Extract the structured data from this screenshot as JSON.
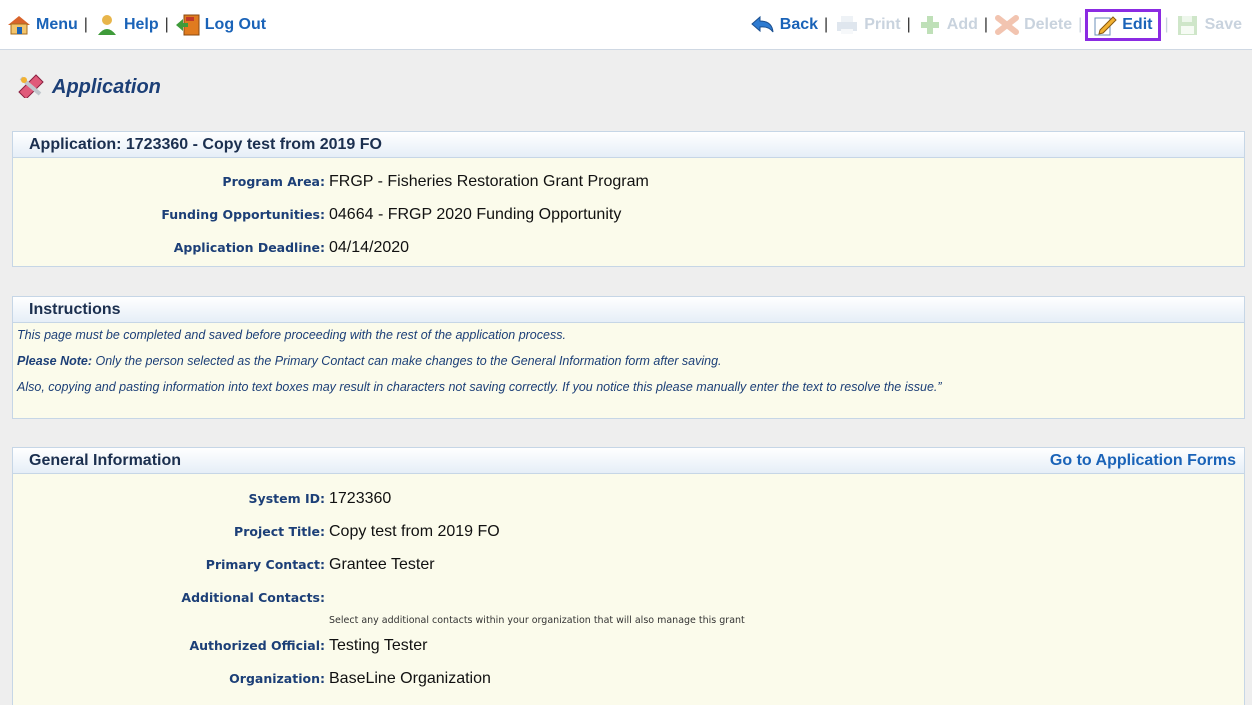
{
  "toolbar": {
    "menu": "Menu",
    "help": "Help",
    "logout": "Log Out",
    "back": "Back",
    "print": "Print",
    "add": "Add",
    "delete": "Delete",
    "edit": "Edit",
    "save": "Save",
    "separator": "|"
  },
  "page": {
    "title": "Application"
  },
  "application_panel": {
    "heading": "Application: 1723360 - Copy test from 2019 FO",
    "fields": [
      {
        "label": "Program Area:",
        "value": "FRGP - Fisheries Restoration Grant Program"
      },
      {
        "label": "Funding Opportunities:",
        "value": "04664 - FRGP 2020 Funding Opportunity"
      },
      {
        "label": "Application Deadline:",
        "value": "04/14/2020"
      }
    ]
  },
  "instructions": {
    "heading": "Instructions",
    "line1": "This page must be completed and saved before proceeding with the rest of the application process.",
    "note_label": "Please Note:",
    "line2": " Only the person selected as the Primary Contact can make changes to the General Information form after saving.",
    "line3": "Also, copying and pasting information into text boxes may result in characters not saving correctly. If you notice this please manually enter the text to resolve the issue.”"
  },
  "general_info": {
    "heading": "General Information",
    "link": "Go to Application Forms",
    "system_id_label": "System ID:",
    "system_id": "1723360",
    "project_title_label": "Project Title:",
    "project_title": "Copy test from 2019 FO",
    "primary_contact_label": "Primary Contact:",
    "primary_contact": "Grantee Tester",
    "additional_contacts_label": "Additional Contacts:",
    "additional_contacts_hint": "Select any additional contacts within your organization that will also manage this grant",
    "authorized_official_label": "Authorized Official:",
    "authorized_official": "Testing Tester",
    "organization_label": "Organization:",
    "organization": "BaseLine Organization"
  },
  "colors": {
    "link": "#1a63b8",
    "highlight": "#8b2be2",
    "panel_bg": "#fbfbeb",
    "label": "#1c3f77"
  }
}
